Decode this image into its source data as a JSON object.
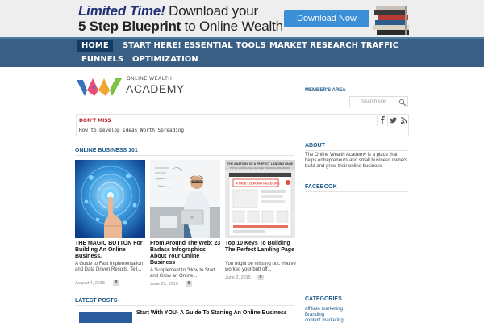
{
  "banner": {
    "limited": "Limited Time!",
    "download_your": " Download your",
    "blueprint": "5 Step Blueprint",
    "to_wealth": " to Online Wealth",
    "button": "Download Now"
  },
  "nav": {
    "items": [
      "HOME",
      "START HERE!",
      "ESSENTIAL TOOLS",
      "MARKET RESEARCH",
      "TRAFFIC",
      "FUNNELS",
      "OPTIMIZATION"
    ],
    "active": "HOME"
  },
  "logo": {
    "line1": "ONLINE WEALTH",
    "line2": "ACADEMY"
  },
  "sidebar": {
    "members": "MEMBER'S AREA",
    "search_placeholder": "Search site",
    "about_heading": "ABOUT",
    "about_text": "The Online Wealth Academy is a place that helps entrepreneurs and small business owners build and grow their online business",
    "facebook_heading": "FACEBOOK",
    "categories_heading": "CATEGORIES",
    "categories": [
      "affiliate marketing",
      "Branding",
      "content marketing"
    ]
  },
  "dont_miss": {
    "label": "DON'T MISS",
    "headline": "How to Develop Ideas Worth Spreading"
  },
  "icons": {
    "facebook": "facebook-icon",
    "twitter": "twitter-icon",
    "rss": "rss-icon",
    "search": "search-icon"
  },
  "section": {
    "online_business": "ONLINE BUSINESS 101",
    "latest": "LATEST POSTS"
  },
  "posts": [
    {
      "title": "THE MAGIC BUTTON For Building An Online Business.",
      "excerpt": "A Guide to Fast Implementation and Data Driven Results. Tell...",
      "date": "August 4, 2015",
      "comments": "0"
    },
    {
      "title": "From Around The Web: 23 Badass Infographics About Your Online Business",
      "excerpt": "A Supplement to “How to Start and Grow an Online...",
      "date": "June 23, 2015",
      "comments": "0"
    },
    {
      "title": "Top 10 Keys To Building The Perfect Landing Page",
      "excerpt": "You might be missing out. You’ve worked your butt off...",
      "date": "June 2, 2015",
      "comments": "0"
    }
  ],
  "infographic": {
    "header": "THE ANATOMY OF A PERFECT LANDING PAGE",
    "sub": "TOP KEY LANDING PAGE FEATURES THAT DRIVE CONVERSIONS",
    "headline": "A NICE LOOKING HEADLINE"
  },
  "latest": {
    "title": "Start With YOU- A Guide To Starting An Online Business"
  },
  "colors": {
    "nav_bg": "#3a5f84",
    "nav_active": "#123a63",
    "accent_blue": "#1d5a8a",
    "dont_miss_red": "#b3202a",
    "button_blue": "#3a8fd6"
  }
}
